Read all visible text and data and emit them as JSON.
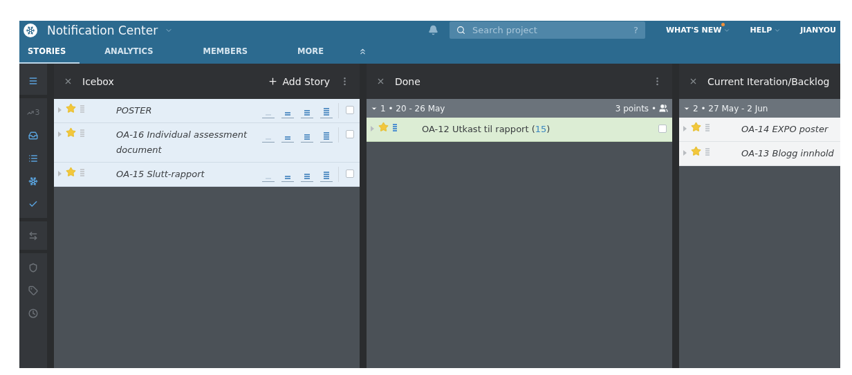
{
  "header": {
    "title": "Notification Center",
    "search": {
      "placeholder": "Search project",
      "help": "?"
    },
    "menus": [
      {
        "label": "WHAT'S NEW",
        "badge": true
      },
      {
        "label": "HELP",
        "badge": false
      },
      {
        "label": "JIANYOU",
        "badge": false
      }
    ]
  },
  "tabs": [
    {
      "label": "STORIES",
      "selected": true
    },
    {
      "label": "ANALYTICS",
      "selected": false
    },
    {
      "label": "MEMBERS",
      "selected": false
    },
    {
      "label": "MORE",
      "selected": false
    }
  ],
  "sidebar": {
    "items": [
      {
        "kind": "stories",
        "on": true
      },
      {
        "kind": "velocity",
        "label": "3",
        "on": false
      },
      {
        "kind": "icebox",
        "on": true
      },
      {
        "kind": "backlog",
        "on": true
      },
      {
        "kind": "snowflake",
        "on": true
      },
      {
        "kind": "done",
        "on": true
      },
      {
        "kind": "arrows",
        "on": false
      },
      {
        "kind": "epics",
        "on": false
      },
      {
        "kind": "labels",
        "on": false
      },
      {
        "kind": "history",
        "on": false
      }
    ]
  },
  "panels": [
    {
      "title": "Icebox",
      "add_button": "Add Story",
      "menu": true,
      "groups": [
        {
          "stories": [
            {
              "title": "POSTER",
              "kind": "unscheduled",
              "estimated": false
            },
            {
              "title": "OA-16 Individual assessment document",
              "kind": "unscheduled",
              "estimated": false
            },
            {
              "title": "OA-15 Slutt-rapport",
              "kind": "unscheduled",
              "estimated": false
            }
          ]
        }
      ]
    },
    {
      "title": "Done",
      "menu": true,
      "groups": [
        {
          "label": "1 • 20 - 26 May",
          "points": "3 points •",
          "stories": [
            {
              "title": "OA-12 Utkast til rapport",
              "count": "(15)",
              "kind": "accepted",
              "estimated": true
            }
          ]
        }
      ]
    },
    {
      "title": "Current Iteration/Backlog",
      "menu": false,
      "groups": [
        {
          "label": "2 • 27 May - 2 Jun",
          "stories": [
            {
              "title": "OA-14 EXPO poster",
              "kind": "unstarted",
              "estimated": false
            },
            {
              "title": "OA-13 Blogg innhold",
              "kind": "unstarted",
              "estimated": false
            }
          ]
        }
      ]
    }
  ]
}
